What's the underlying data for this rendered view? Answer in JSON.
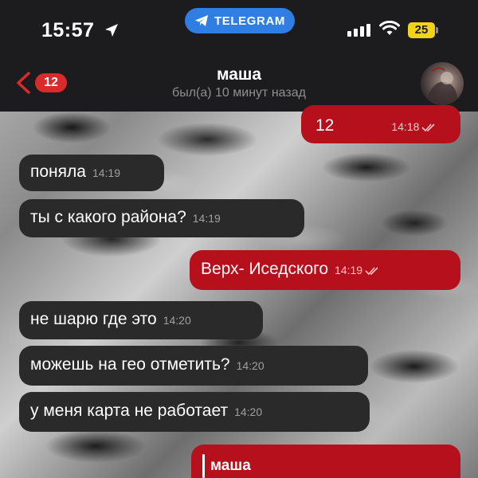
{
  "status_bar": {
    "time": "15:57",
    "pill_label": "TELEGRAM",
    "battery": "25"
  },
  "header": {
    "back_count": "12",
    "name": "маша",
    "last_seen": "был(а) 10 минут назад"
  },
  "messages": [
    {
      "direction": "out",
      "text": "12",
      "time": "14:18",
      "read": true
    },
    {
      "direction": "in",
      "text": "поняла",
      "time": "14:19"
    },
    {
      "direction": "in",
      "text": "ты с какого района?",
      "time": "14:19"
    },
    {
      "direction": "out",
      "text": "Верх- Иседского",
      "time": "14:19",
      "read": true
    },
    {
      "direction": "in",
      "text": "не шарю где это",
      "time": "14:20"
    },
    {
      "direction": "in",
      "text": "можешь на гео отметить?",
      "time": "14:20"
    },
    {
      "direction": "in",
      "text": "у меня карта не работает",
      "time": "14:20"
    }
  ],
  "reply_preview": {
    "name": "маша"
  },
  "colors": {
    "outgoing_bubble": "#b5101c",
    "incoming_bubble": "#2a2a2a",
    "telegram_pill": "#2f7ee3",
    "back_badge": "#d92b2b",
    "battery": "#f2d21b"
  }
}
